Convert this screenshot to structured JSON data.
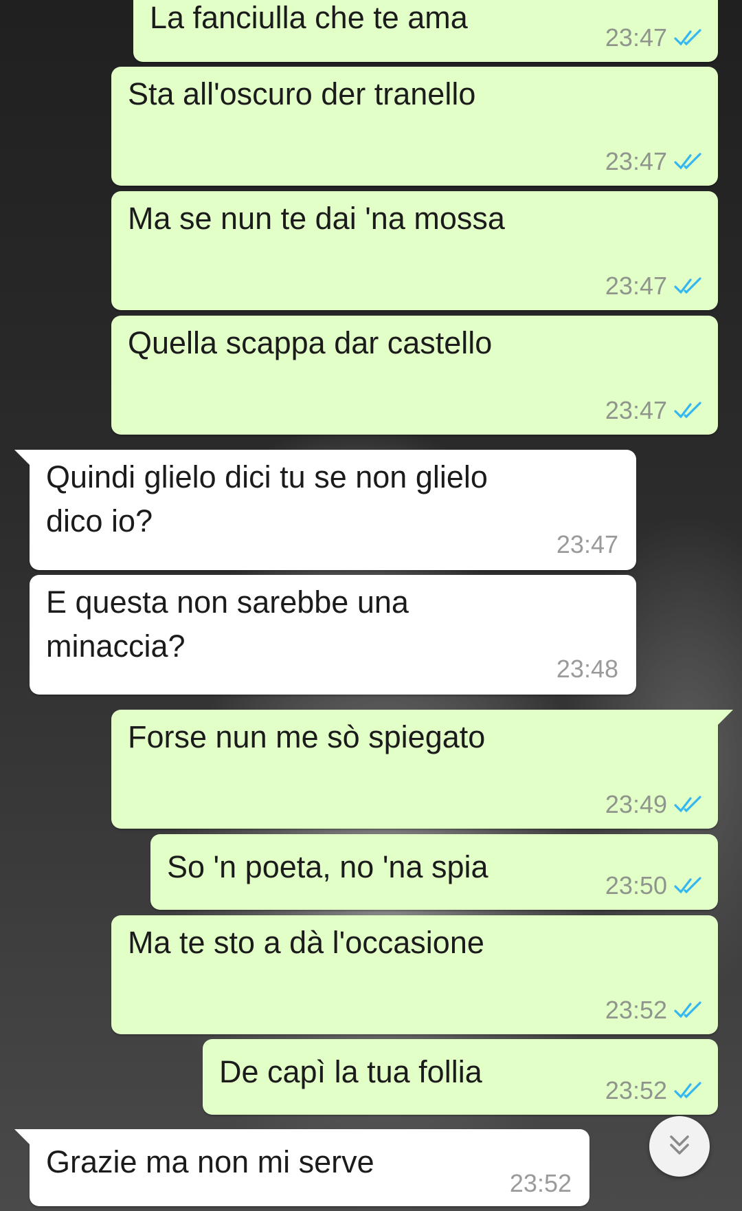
{
  "messages": [
    {
      "id": "m1",
      "dir": "out",
      "text": "La fanciulla che te ama",
      "time": "23:47",
      "read": true
    },
    {
      "id": "m2",
      "dir": "out",
      "text": "Sta all'oscuro der tranello",
      "time": "23:47",
      "read": true
    },
    {
      "id": "m3",
      "dir": "out",
      "text": "Ma se nun te dai 'na mossa",
      "time": "23:47",
      "read": true
    },
    {
      "id": "m4",
      "dir": "out",
      "text": "Quella scappa dar castello",
      "time": "23:47",
      "read": true
    },
    {
      "id": "m5",
      "dir": "in",
      "text": "Quindi glielo dici tu se non glielo\ndico io?",
      "time": "23:47"
    },
    {
      "id": "m6",
      "dir": "in",
      "text": "E questa non sarebbe una\nminaccia?",
      "time": "23:48"
    },
    {
      "id": "m7",
      "dir": "out",
      "text": "Forse nun me sò spiegato",
      "time": "23:49",
      "read": true
    },
    {
      "id": "m8",
      "dir": "out",
      "text": "So 'n poeta, no 'na spia",
      "time": "23:50",
      "read": true
    },
    {
      "id": "m9",
      "dir": "out",
      "text": "Ma te sto a dà l'occasione",
      "time": "23:52",
      "read": true
    },
    {
      "id": "m10",
      "dir": "out",
      "text": "De capì la tua follia",
      "time": "23:52",
      "read": true
    },
    {
      "id": "m11",
      "dir": "in",
      "text": "Grazie ma non mi serve",
      "time": "23:52"
    }
  ],
  "colors": {
    "outgoing_bubble": "#e1ffc7",
    "incoming_bubble": "#ffffff",
    "read_tick": "#34b7f1",
    "timestamp": "#8f958c"
  },
  "icons": {
    "read_receipt": "double-check-icon",
    "scroll_down": "chevron-double-down-icon"
  }
}
